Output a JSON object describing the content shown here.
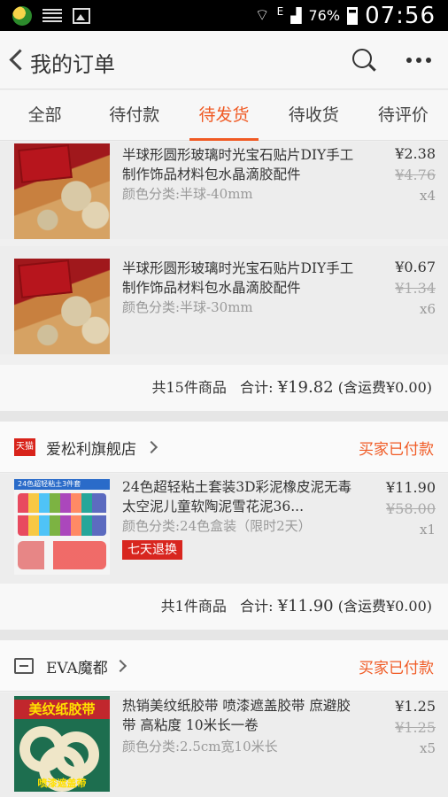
{
  "status_bar": {
    "battery": "76%",
    "time": "07:56",
    "network": "E"
  },
  "header": {
    "title": "我的订单"
  },
  "tabs": [
    {
      "label": "全部"
    },
    {
      "label": "待付款"
    },
    {
      "label": "待发货",
      "active": true
    },
    {
      "label": "待收货"
    },
    {
      "label": "待评价"
    }
  ],
  "orders": [
    {
      "items": [
        {
          "name": "半球形圆形玻璃时光宝石贴片DIY手工制作饰品材料包水晶滴胶配件",
          "variant": "颜色分类:半球-40mm",
          "price": "¥2.38",
          "original_price": "¥4.76",
          "qty": "x4"
        },
        {
          "name": "半球形圆形玻璃时光宝石贴片DIY手工制作饰品材料包水晶滴胶配件",
          "variant": "颜色分类:半球-30mm",
          "price": "¥0.67",
          "original_price": "¥1.34",
          "qty": "x6"
        }
      ],
      "summary": {
        "count_text": "共15件商品",
        "total_label": "合计:",
        "total": "¥19.82",
        "shipping": "(含运费¥0.00)"
      }
    },
    {
      "shop": {
        "name": "爱松利旗舰店",
        "badge": "天猫",
        "status": "买家已付款"
      },
      "items": [
        {
          "name": "24色超轻粘土套装3D彩泥橡皮泥无毒太空泥儿童软陶泥雪花泥36...",
          "variant": "颜色分类:24色盒装（限时2天）",
          "price": "¥11.90",
          "original_price": "¥58.00",
          "qty": "x1",
          "tag": "七天退换",
          "thumb_header": "24色超轻粘土3件套"
        }
      ],
      "summary": {
        "count_text": "共1件商品",
        "total_label": "合计:",
        "total": "¥11.90",
        "shipping": "(含运费¥0.00)"
      }
    },
    {
      "shop": {
        "name": "EVA魔都",
        "status": "买家已付款"
      },
      "items": [
        {
          "name": "热销美纹纸胶带 喷漆遮盖胶带 庶避胶带 高粘度 10米长一卷",
          "variant": "颜色分类:2.5cm宽10米长",
          "price": "¥1.25",
          "original_price": "¥1.25",
          "qty": "x5",
          "thumb_banner": "美纹纸胶带",
          "thumb_footer": "喷漆遮盖带"
        }
      ]
    }
  ],
  "colors": {
    "accent": "#f05a24",
    "tag_red": "#d8261f"
  },
  "icons": [
    "back-arrow-icon",
    "search-icon",
    "more-icon",
    "tmall-icon",
    "store-icon",
    "chevron-right-icon"
  ]
}
